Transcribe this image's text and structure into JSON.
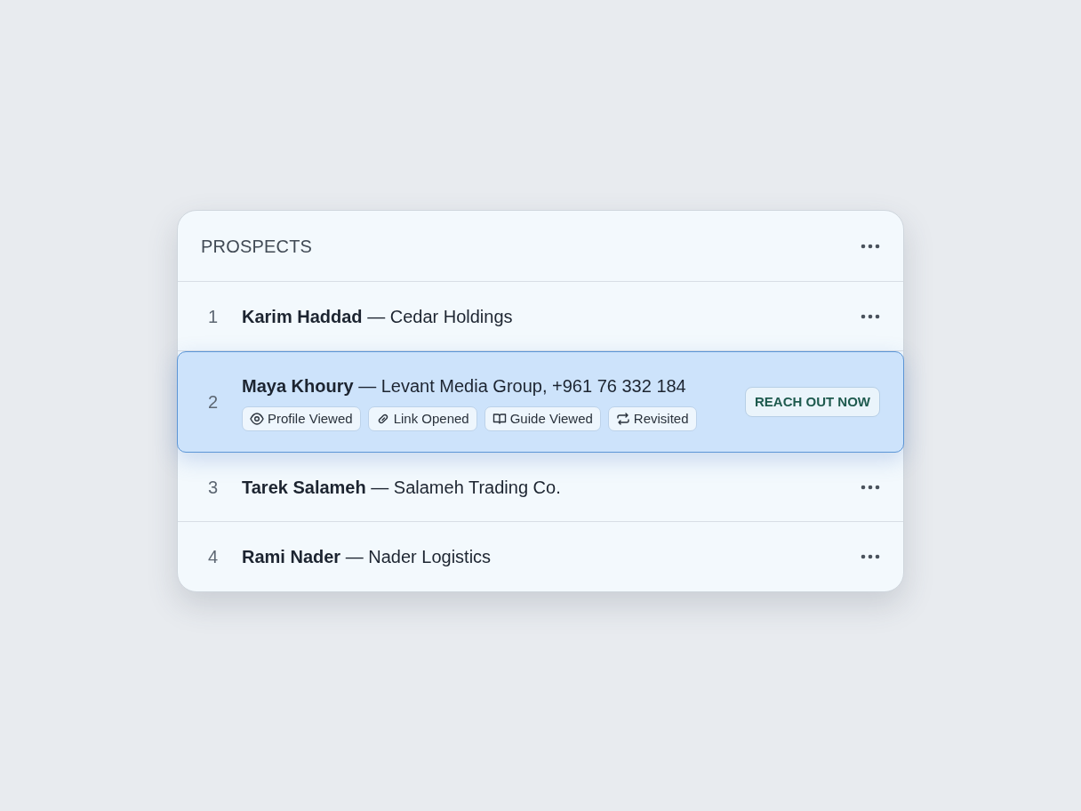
{
  "panel": {
    "title": "PROSPECTS"
  },
  "rows": [
    {
      "number": "1",
      "text": "**Karim Haddad** — Cedar Holdings",
      "selected": false
    },
    {
      "number": "2",
      "text": "**Maya Khoury** — Levant Media Group, +961 76 332 184",
      "selected": true,
      "tags": [
        {
          "kind": "eye",
          "label": "Profile Viewed"
        },
        {
          "kind": "link",
          "label": "Link Opened"
        },
        {
          "kind": "book",
          "label": "Guide Viewed"
        },
        {
          "kind": "repeat",
          "label": "Revisited"
        }
      ],
      "action": "REACH OUT NOW"
    },
    {
      "number": "3",
      "text": "**Tarek Salameh** — Salameh Trading Co.",
      "selected": false
    },
    {
      "number": "4",
      "text": "**Rami Nader** — Nader Logistics",
      "selected": false
    }
  ]
}
